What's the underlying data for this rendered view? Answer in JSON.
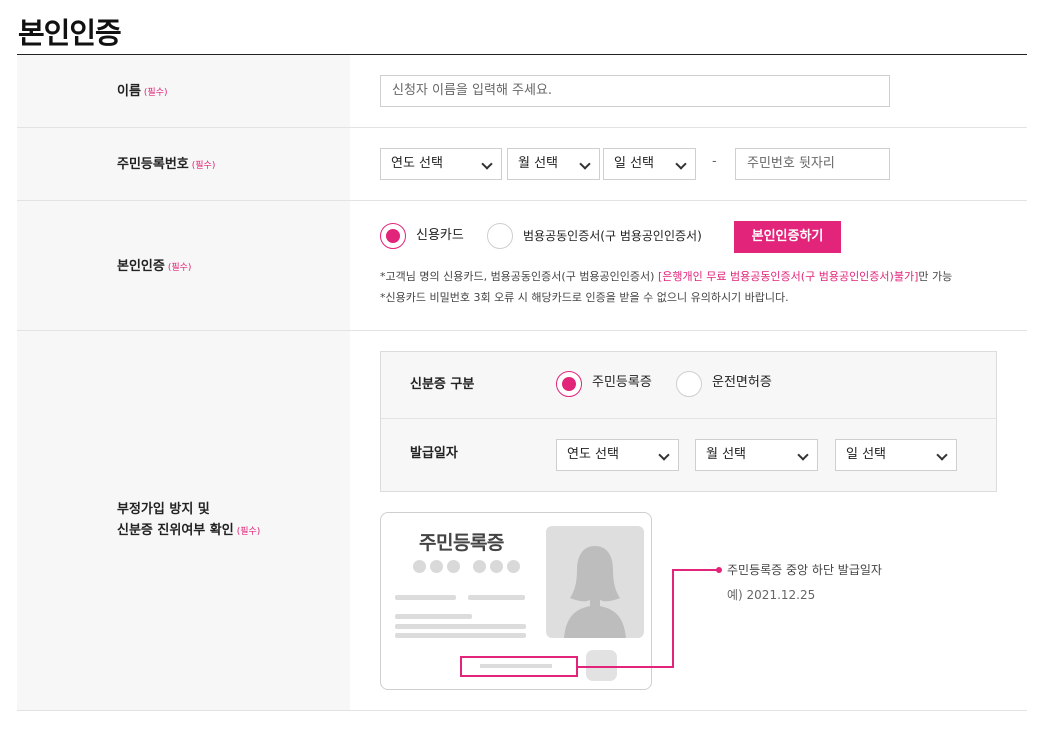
{
  "page": {
    "title": "본인인증"
  },
  "required_mark": "(필수)",
  "name_row": {
    "label": "이름",
    "placeholder": "신청자 이름을 입력해 주세요."
  },
  "rrn_row": {
    "label": "주민등록번호",
    "year_select": "연도 선택",
    "month_select": "월 선택",
    "day_select": "일 선택",
    "separator": "-",
    "back_placeholder": "주민번호 뒷자리"
  },
  "auth_row": {
    "label": "본인인증",
    "option_card": "신용카드",
    "option_cert": "범용공동인증서(구 범용공인인증서)",
    "selected": "신용카드",
    "button": "본인인증하기",
    "note1_prefix": "*고객님 명의 신용카드, 범용공동인증서(구 범용공인인증서) ",
    "note1_highlight": "[은행개인 무료 범용공동인증서(구 범용공인인증서)불가]",
    "note1_suffix": "만 가능",
    "note2": "*신용카드 비밀번호 3회 오류 시 해당카드로 인증을 받을 수 없으니 유의하시기 바랍니다."
  },
  "identity_row": {
    "label_line1": "부정가입 방지 및",
    "label_line2": "신분증 진위여부 확인",
    "id_type_label": "신분증 구분",
    "id_option_rrn": "주민등록증",
    "id_option_license": "운전면허증",
    "selected": "주민등록증",
    "issue_date_label": "발급일자",
    "year_select": "연도 선택",
    "month_select": "월 선택",
    "day_select": "일 선택",
    "card_title": "주민등록증",
    "callout_text": "주민등록증 중앙 하단 발급일자",
    "callout_example": "예) 2021.12.25"
  },
  "colors": {
    "accent": "#e2247a",
    "label_bg": "#f7f7f7",
    "border": "#cfcfcf"
  },
  "icons": [
    "chevron-down-icon",
    "person-silhouette-icon"
  ]
}
